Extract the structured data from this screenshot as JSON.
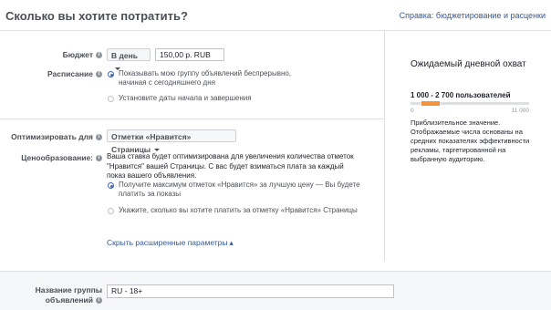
{
  "header": {
    "title": "Сколько вы хотите потратить?",
    "help_link": "Справка: бюджетирование и расценки"
  },
  "budget": {
    "label": "Бюджет",
    "period": "В день",
    "amount": "150,00 р. RUB"
  },
  "schedule": {
    "label": "Расписание",
    "options": [
      "Показывать мою группу объявлений беспрерывно, начиная с сегодняшнего дня",
      "Установите даты начала и завершения"
    ],
    "selected": 0
  },
  "optimize": {
    "label": "Оптимизировать для",
    "value": "Отметки «Нравится» Страницы"
  },
  "pricing": {
    "label": "Ценообразование:",
    "description": "Ваша ставка будет оптимизирована для увеличения количества отметок \"Нравится\" вашей Страницы. С вас будет взиматься плата за каждый показ вашего объявления.",
    "options": [
      "Получите максимум отметок «Нравится» за лучшую цену — Вы будете платить за показы",
      "Укажите, сколько вы хотите платить за отметку «Нравится» Страницы"
    ],
    "selected": 0
  },
  "advanced_link": "Скрыть расширенные параметры",
  "reach_panel": {
    "title": "Ожидаемый дневной охват",
    "range": "1 000 - 2 700 пользователей",
    "min": "0",
    "max": "11 000",
    "range_start_fraction": 0.09,
    "range_end_fraction": 0.245,
    "description": "Приблизительное значение. Отображаемые числа основаны на средних показателях эффективности рекламы, таргетированной на выбранную аудиторию."
  },
  "adset_name": {
    "label": "Название группы объявлений",
    "value": "RU - 18+"
  },
  "colors": {
    "accent": "#4267b2",
    "link": "#365899",
    "reach_bar": "#f7923a"
  }
}
